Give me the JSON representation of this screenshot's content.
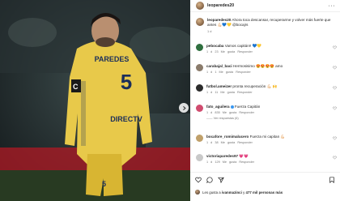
{
  "post": {
    "author": "leoparedes20",
    "caption": "Ahora toca descansar, recuperarme y volver más fuerte que antes 💪🏻💙💛 @bocajrs",
    "caption_time": "1 d",
    "jersey": {
      "name": "PAREDES",
      "number": "5",
      "sponsor": "DIRECTV"
    }
  },
  "comments": [
    {
      "user": "pebocaba",
      "text": "Vamos capitán!! 💙💛",
      "time": "1 d",
      "likes": "23 Me gusta",
      "reply": "Responder",
      "color": "#2f6f3f"
    },
    {
      "user": "carabajal_baci",
      "text": "Hermosisimo 😍😍😍😍 amo",
      "time": "1 d",
      "likes": "1 Me gusta",
      "reply": "Responder",
      "color": "#8a7b6b"
    },
    {
      "user": "futbol.ameizer",
      "text": "pronta recuperación 💪🏻 🙌",
      "time": "1 d",
      "likes": "11 Me gusta",
      "reply": "Responder",
      "color": "#2b2b2b"
    },
    {
      "user": "fato_aguilera",
      "text": "Fuerza Capitán",
      "time": "1 d",
      "likes": "835 Me gusta",
      "reply": "Responder",
      "replies": "Ver respuestas (6)",
      "color": "#d04c6f"
    },
    {
      "user": "bocafore_romimalucero",
      "text": "Fuerza mi capitan 💪🏻",
      "time": "1 d",
      "likes": "38 Me gusta",
      "reply": "Responder",
      "color": "#c0a06a"
    },
    {
      "user": "victoriaparedes97",
      "text": "💗💗",
      "time": "1 d",
      "likes": "129 Me gusta",
      "reply": "Responder",
      "color": "#c9c9c9"
    }
  ],
  "actions": {
    "likes_text_prefix": "Les gusta a",
    "likes_user": "ivanmazinci",
    "likes_text_mid": "y",
    "likes_count": "477 mil personas más"
  }
}
